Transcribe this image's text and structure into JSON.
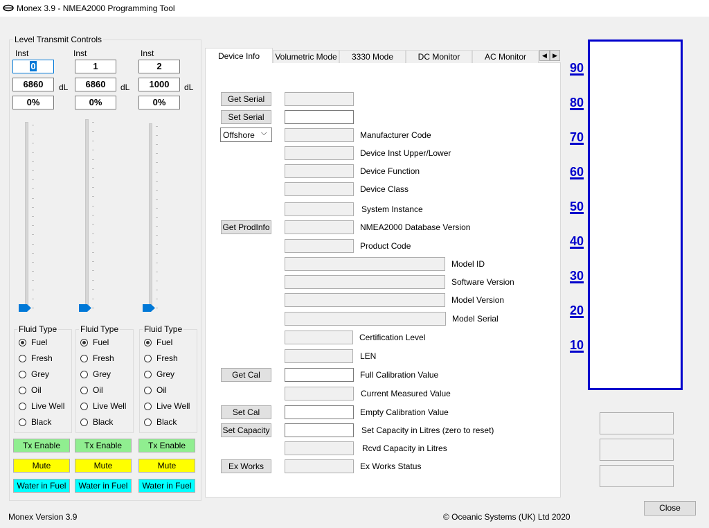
{
  "window": {
    "title": "Monex 3.9 - NMEA2000 Programming Tool"
  },
  "level_group": {
    "label": "Level Transmit Controls"
  },
  "channels": [
    {
      "inst_label": "Inst",
      "inst": "0",
      "value": "6860",
      "unit": "dL",
      "percent": "0%",
      "fluid_label": "Fluid Type",
      "selected": "Fuel",
      "tx_label": "Tx Enable",
      "mute_label": "Mute",
      "wif_label": "Water in Fuel",
      "slider_level": 0
    },
    {
      "inst_label": "Inst",
      "inst": "1",
      "value": "6860",
      "unit": "dL",
      "percent": "0%",
      "fluid_label": "Fluid Type",
      "selected": "Fuel",
      "tx_label": "Tx Enable",
      "mute_label": "Mute",
      "wif_label": "Water in Fuel",
      "slider_level": 0
    },
    {
      "inst_label": "Inst",
      "inst": "2",
      "value": "1000",
      "unit": "dL",
      "percent": "0%",
      "fluid_label": "Fluid Type",
      "selected": "Fuel",
      "tx_label": "Tx Enable",
      "mute_label": "Mute",
      "wif_label": "Water in Fuel",
      "slider_level": 0
    }
  ],
  "fluid_types": [
    "Fuel",
    "Fresh",
    "Grey",
    "Oil",
    "Live Well",
    "Black"
  ],
  "colors": {
    "tx": "#90ee90",
    "mute": "#ffff00",
    "wif": "#00ffff",
    "scale": "#0000cc",
    "accent": "#0078d7"
  },
  "tabs": [
    "Device Info",
    "Volumetric Mode",
    "3330 Mode",
    "DC Monitor",
    "AC Monitor"
  ],
  "active_tab": "Device Info",
  "buttons": {
    "get_serial": "Get Serial",
    "set_serial": "Set Serial",
    "get_prodinfo": "Get ProdInfo",
    "get_cal": "Get Cal",
    "set_cal": "Set Cal",
    "set_capacity": "Set Capacity",
    "ex_works": "Ex Works",
    "close": "Close"
  },
  "dropdown": {
    "selected": "Offshore"
  },
  "labels": {
    "manufacturer_code": "Manufacturer Code",
    "device_inst": "Device Inst Upper/Lower",
    "device_function": "Device Function",
    "device_class": "Device Class",
    "system_instance": "System Instance",
    "db_version": "NMEA2000 Database Version",
    "product_code": "Product Code",
    "model_id": "Model ID",
    "software_version": "Software Version",
    "model_version": "Model Version",
    "model_serial": "Model Serial",
    "cert_level": "Certification Level",
    "len": "LEN",
    "full_cal": "Full Calibration Value",
    "current_measured": "Current Measured Value",
    "empty_cal": "Empty Calibration Value",
    "set_capacity_litres": "Set Capacity in Litres (zero to reset)",
    "rcvd_capacity": "Rcvd Capacity in Litres",
    "ex_works_status": "Ex Works Status"
  },
  "scale": [
    "90",
    "80",
    "70",
    "60",
    "50",
    "40",
    "30",
    "20",
    "10"
  ],
  "status": {
    "version": "Monex Version 3.9",
    "copyright": "© Oceanic Systems (UK) Ltd 2020"
  }
}
